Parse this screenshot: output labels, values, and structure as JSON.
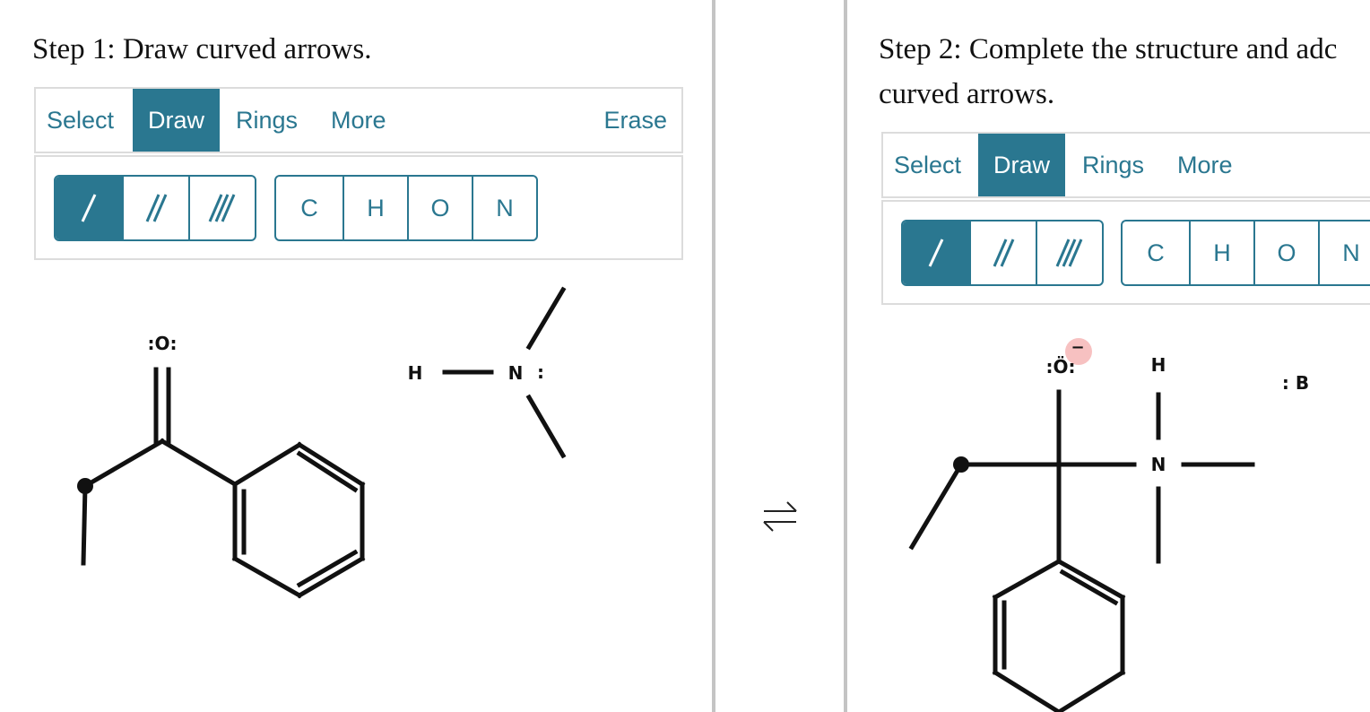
{
  "step1": {
    "title": "Step 1: Draw curved arrows.",
    "tabs": {
      "select": "Select",
      "draw": "Draw",
      "rings": "Rings",
      "more": "More",
      "erase": "Erase"
    },
    "atoms": {
      "c": "C",
      "h": "H",
      "o": "O",
      "n": "N"
    },
    "molecule_labels": {
      "oxygen": ":O:",
      "hydrogen": "H",
      "nitrogen": "N",
      "nitrogen_lone_pair": ":"
    }
  },
  "step2": {
    "title_line1": "Step 2: Complete the structure and adc",
    "title_line2": "curved arrows.",
    "tabs": {
      "select": "Select",
      "draw": "Draw",
      "rings": "Rings",
      "more": "More"
    },
    "atoms": {
      "c": "C",
      "h": "H",
      "o": "O",
      "n": "N"
    },
    "molecule_labels": {
      "oxygen": ":Ö:",
      "charge": "−",
      "hydrogen": "H",
      "nitrogen": "N",
      "base": ": B"
    }
  },
  "equilibrium_symbol": "⇌",
  "icons": [
    "single-bond-icon",
    "double-bond-icon",
    "triple-bond-icon"
  ],
  "colors": {
    "accent": "#2a7790",
    "divider": "#c4c4c4",
    "charge_highlight": "#f6b6b6"
  }
}
